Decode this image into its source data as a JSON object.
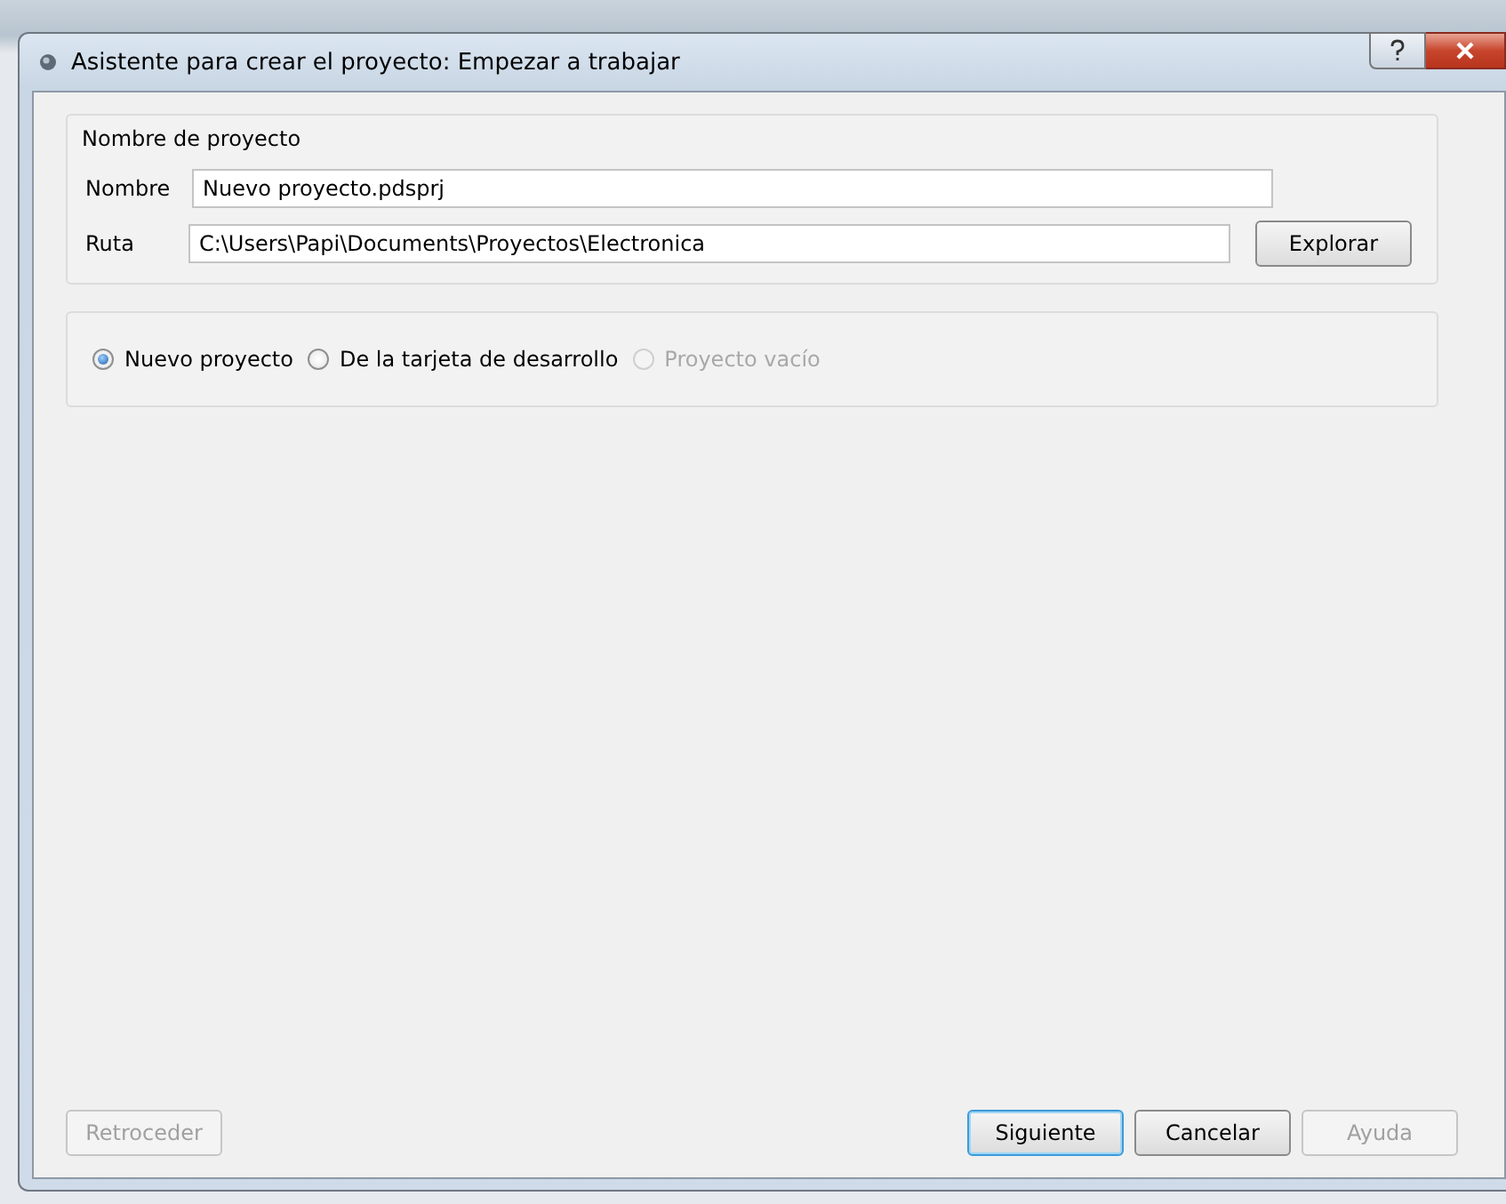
{
  "window": {
    "title": "Asistente para crear el proyecto: Empezar a trabajar"
  },
  "project_group": {
    "title": "Nombre de proyecto",
    "fields": [
      {
        "label": "Nombre",
        "value": "Nuevo proyecto.pdsprj"
      },
      {
        "label": "Ruta",
        "value": "C:\\Users\\Papi\\Documents\\Proyectos\\Electronica",
        "button": "Explorar"
      }
    ]
  },
  "options": [
    {
      "label": "Nuevo proyecto",
      "selected": true,
      "disabled": false
    },
    {
      "label": "De la tarjeta de desarrollo",
      "selected": false,
      "disabled": false
    },
    {
      "label": "Proyecto vacío",
      "selected": false,
      "disabled": true
    }
  ],
  "back_button": {
    "label": "Retroceder",
    "disabled": true,
    "default": false
  },
  "buttons": [
    {
      "label": "Siguiente",
      "disabled": false,
      "default": true
    },
    {
      "label": "Cancelar",
      "disabled": false,
      "default": false
    },
    {
      "label": "Ayuda",
      "disabled": true,
      "default": false
    }
  ]
}
